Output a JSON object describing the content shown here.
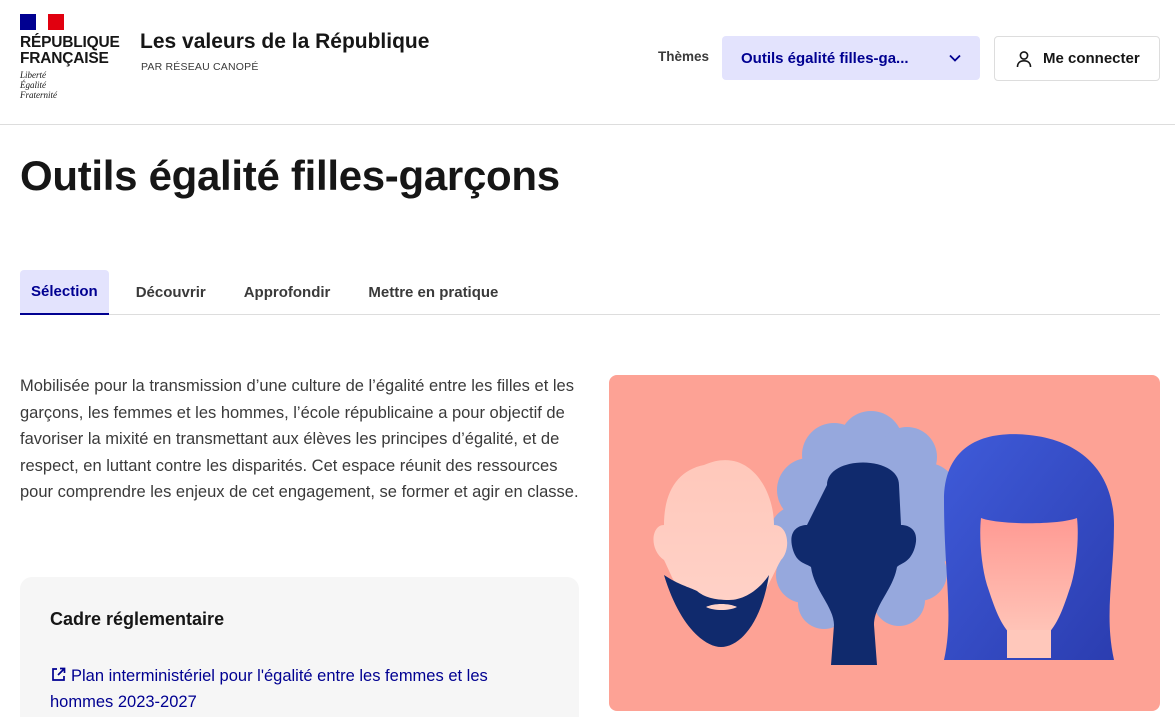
{
  "header": {
    "logo": {
      "line1": "RÉPUBLIQUE",
      "line2": "FRANÇAISE",
      "motto1": "Liberté",
      "motto2": "Égalité",
      "motto3": "Fraternité"
    },
    "site_title": "Les valeurs de la République",
    "site_subtitle": "PAR RÉSEAU CANOPÉ",
    "themes_label": "Thèmes",
    "themes_selected": "Outils égalité filles-ga...",
    "login_label": "Me connecter"
  },
  "page": {
    "title": "Outils égalité filles-garçons",
    "tabs": [
      {
        "label": "Sélection",
        "active": true
      },
      {
        "label": "Découvrir"
      },
      {
        "label": "Approfondir"
      },
      {
        "label": "Mettre en pratique"
      }
    ],
    "intro": "Mobilisée pour la transmission d’une culture de l’égalité entre les filles et les garçons, les femmes et les hommes, l’école républicaine a pour objectif de favoriser la mixité en transmettant aux élèves les principes d’égalité, et de respect, en luttant contre les disparités. Cet espace réunit des ressources pour comprendre les enjeux de cet engagement, se former et agir en classe.",
    "card": {
      "title": "Cadre réglementaire",
      "link": "Plan interministériel pour l'égalité entre les femmes et les hommes 2023-2027"
    }
  },
  "colors": {
    "accent": "#000091",
    "accent_bg": "#e3e3fd",
    "illustration_bg": "#fda295"
  },
  "icons": {
    "themes_chevron": "chevron-down-icon",
    "login": "user-icon",
    "link": "external-link-icon"
  }
}
